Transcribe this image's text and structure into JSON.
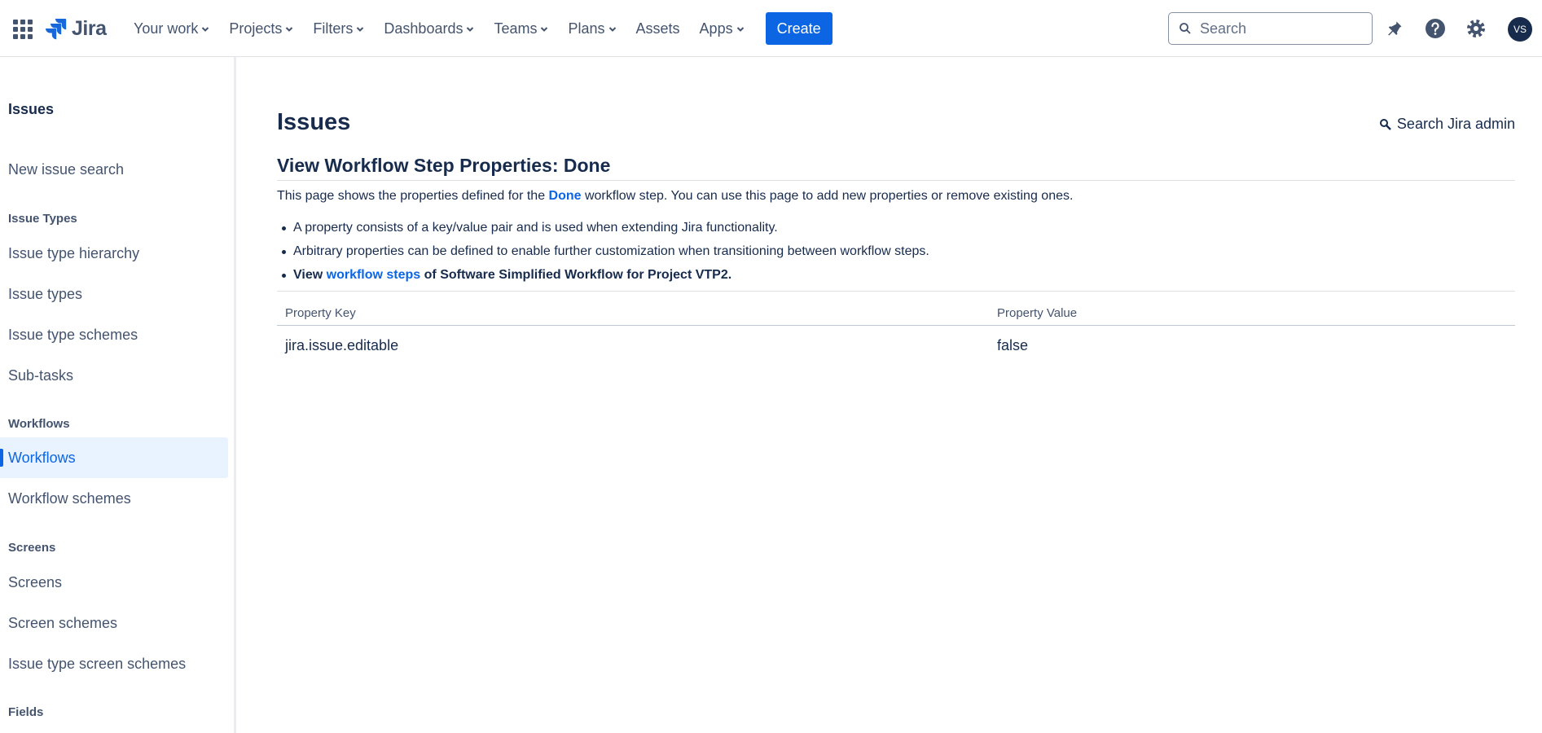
{
  "brand": {
    "name": "Jira",
    "accent": "#0c66e4"
  },
  "topnav": {
    "items": [
      "Your work",
      "Projects",
      "Filters",
      "Dashboards",
      "Teams",
      "Plans",
      "Assets",
      "Apps"
    ],
    "create_label": "Create",
    "search_placeholder": "Search",
    "avatar_initials": "VS",
    "icons": [
      "app-switcher-icon",
      "notifications-icon",
      "help-icon",
      "settings-icon"
    ]
  },
  "sidebar": {
    "title": "Issues",
    "new_issue_search": "New issue search",
    "groups": {
      "issue_types": {
        "label": "Issue Types",
        "items": [
          "Issue type hierarchy",
          "Issue types",
          "Issue type schemes",
          "Sub-tasks"
        ]
      },
      "workflows": {
        "label": "Workflows",
        "items": [
          "Workflows",
          "Workflow schemes"
        ],
        "active": "Workflows"
      },
      "screens": {
        "label": "Screens",
        "items": [
          "Screens",
          "Screen schemes",
          "Issue type screen schemes"
        ]
      },
      "fields": {
        "label": "Fields"
      }
    }
  },
  "main": {
    "page_title": "Issues",
    "admin_search_label": "Search Jira admin",
    "section_title": "View Workflow Step Properties: Done",
    "description": {
      "before": "This page shows the properties defined for the ",
      "link": "Done",
      "after": " workflow step. You can use this page to add new properties or remove existing ones."
    },
    "bullets": {
      "one": "A property consists of a key/value pair and is used when extending Jira functionality.",
      "two": "Arbitrary properties can be defined to enable further customization when transitioning between workflow steps.",
      "three_prefix": "View ",
      "three_link": "workflow steps",
      "three_suffix": " of Software Simplified Workflow for Project VTP2."
    },
    "table": {
      "headers": [
        "Property Key",
        "Property Value"
      ],
      "rows": [
        {
          "key": "jira.issue.editable",
          "value": "false"
        }
      ]
    }
  }
}
